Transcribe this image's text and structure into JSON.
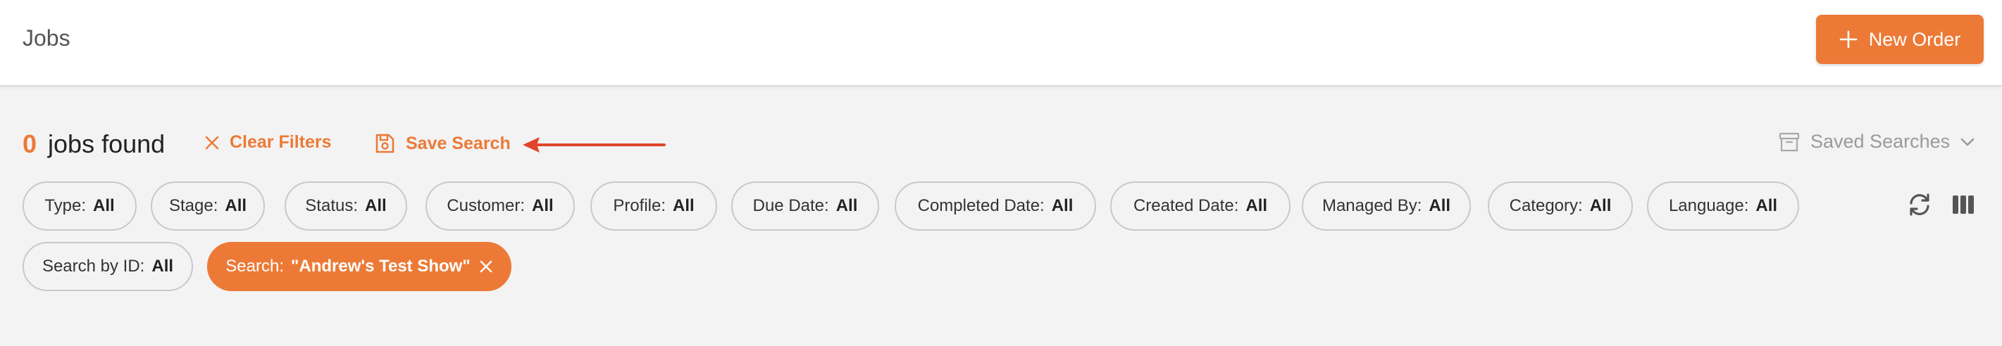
{
  "header": {
    "title": "Jobs",
    "new_order_label": "New Order"
  },
  "results": {
    "count": "0",
    "label": "jobs found"
  },
  "actions": {
    "clear_filters": "Clear Filters",
    "save_search": "Save Search",
    "saved_searches": "Saved Searches"
  },
  "filters": [
    {
      "key": "Type:",
      "value": "All"
    },
    {
      "key": "Stage:",
      "value": "All"
    },
    {
      "key": "Status:",
      "value": "All"
    },
    {
      "key": "Customer:",
      "value": "All"
    },
    {
      "key": "Profile:",
      "value": "All"
    },
    {
      "key": "Due Date:",
      "value": "All"
    },
    {
      "key": "Completed Date:",
      "value": "All"
    },
    {
      "key": "Created Date:",
      "value": "All"
    },
    {
      "key": "Managed By:",
      "value": "All"
    },
    {
      "key": "Category:",
      "value": "All"
    },
    {
      "key": "Language:",
      "value": "All"
    },
    {
      "key": "Search by ID:",
      "value": "All"
    },
    {
      "key": "Search:",
      "value": "\"Andrew's Test Show\""
    }
  ],
  "icons": {
    "new_order": "plus-icon",
    "clear": "close-icon",
    "save": "floppy-disk-icon",
    "saved_searches": "archive-box-icon",
    "saved_searches_toggle": "chevron-down-icon",
    "refresh": "refresh-icon",
    "columns": "columns-icon",
    "remove_search": "close-icon",
    "annotation": "arrow-left-icon"
  },
  "colors": {
    "accent": "#ec7a36",
    "annotation_arrow": "#e0452b",
    "background": "#f3f3f3",
    "header_bg": "#ffffff",
    "muted_text": "#9a9a9a"
  }
}
